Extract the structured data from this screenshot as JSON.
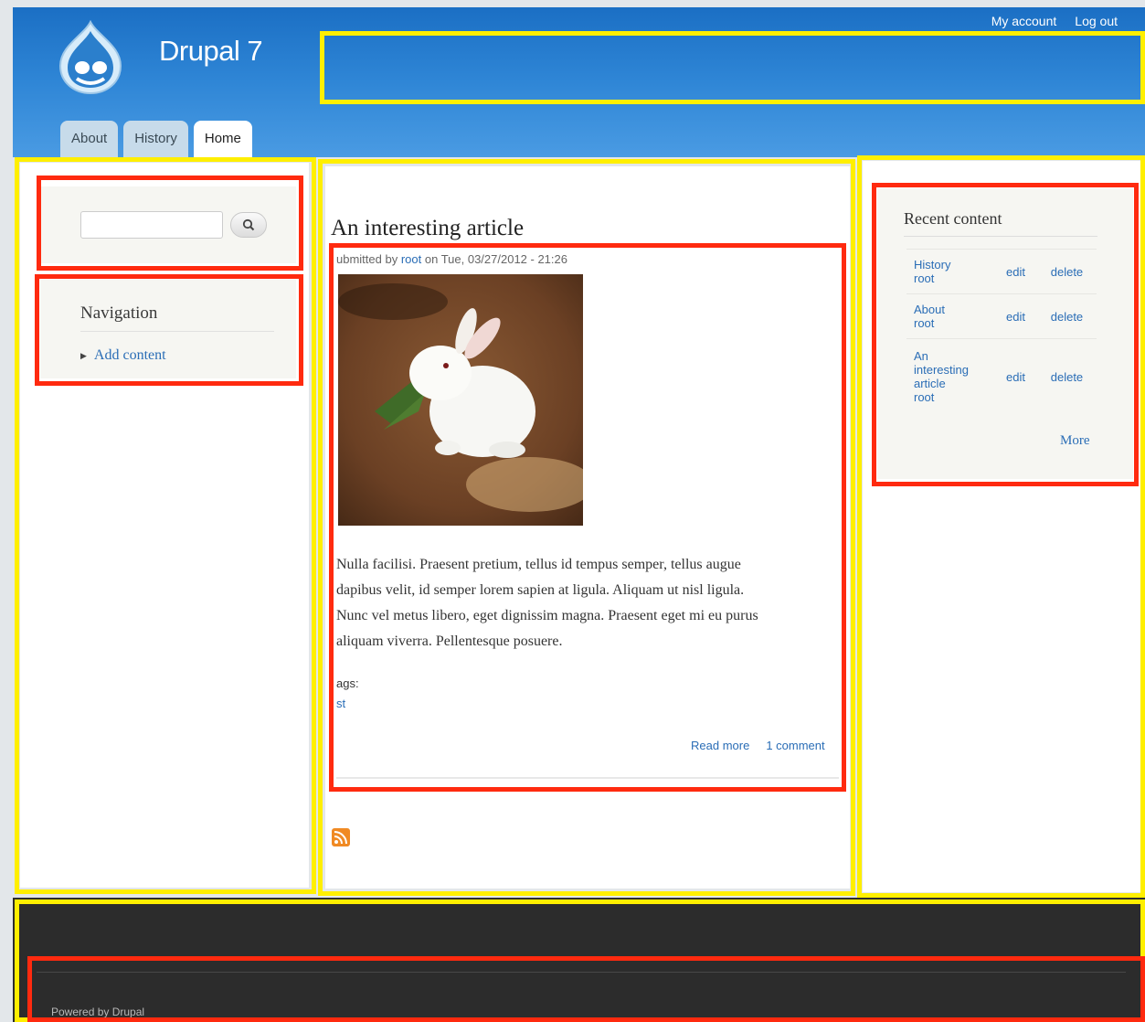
{
  "header": {
    "site_name": "Drupal 7",
    "secondary_menu": [
      "My account",
      "Log out"
    ],
    "tabs": [
      {
        "label": "About"
      },
      {
        "label": "History"
      },
      {
        "label": "Home"
      }
    ],
    "active_tab": "Home"
  },
  "sidebar_first": {
    "search": {
      "placeholder": "",
      "value": "",
      "button_icon": "search-icon"
    },
    "navigation": {
      "title": "Navigation",
      "items": [
        {
          "label": "Add content"
        }
      ]
    }
  },
  "main": {
    "article": {
      "title": "An interesting article",
      "submitted_prefix": "ubmitted by",
      "author": "root",
      "submitted_suffix": "on Tue, 03/27/2012 - 21:26",
      "body_lines": [
        "Nulla facilisi. Praesent pretium, tellus id tempus semper, tellus augue",
        "dapibus velit, id semper lorem sapien at ligula. Aliquam ut nisl ligula.",
        "Nunc vel metus libero, eget dignissim magna. Praesent eget mi eu purus",
        "aliquam viverra. Pellentesque posuere."
      ],
      "tags_label": "ags:",
      "tag": "st",
      "read_more": "Read more",
      "comments": "1 comment"
    },
    "feed_icon": "rss-icon"
  },
  "sidebar_second": {
    "recent_content": {
      "title": "Recent content",
      "rows": [
        {
          "title_lines": [
            "History"
          ],
          "author": "root",
          "edit": "edit",
          "delete": "delete"
        },
        {
          "title_lines": [
            "About"
          ],
          "author": "root",
          "edit": "edit",
          "delete": "delete"
        },
        {
          "title_lines": [
            "An",
            "interesting",
            "article"
          ],
          "author": "root",
          "edit": "edit",
          "delete": "delete"
        }
      ],
      "more": "More"
    }
  },
  "footer": {
    "text": "Powered by Drupal"
  },
  "colors": {
    "annotation_yellow": "#ffef00",
    "annotation_red": "#ff2a0f",
    "header_blue": "#2f86d6",
    "link_blue": "#2a6db6",
    "footer_dark": "#2c2c2c"
  }
}
